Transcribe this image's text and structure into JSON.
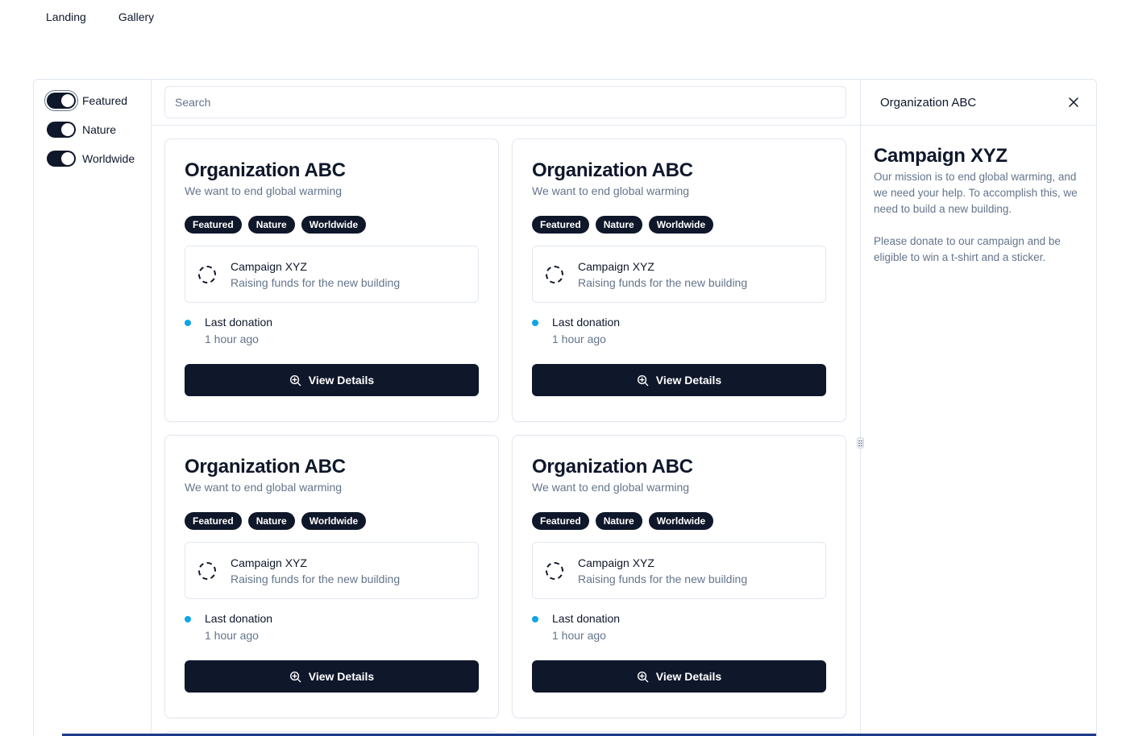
{
  "nav": {
    "items": [
      "Landing",
      "Gallery"
    ]
  },
  "filters": [
    {
      "label": "Featured",
      "on": true
    },
    {
      "label": "Nature",
      "on": true
    },
    {
      "label": "Worldwide",
      "on": true
    }
  ],
  "search": {
    "placeholder": "Search",
    "value": ""
  },
  "cards": [
    {
      "title": "Organization ABC",
      "subtitle": "We want to end global warming",
      "badges": [
        "Featured",
        "Nature",
        "Worldwide"
      ],
      "campaign_title": "Campaign XYZ",
      "campaign_sub": "Raising funds for the new building",
      "donation_label": "Last donation",
      "donation_time": "1 hour ago",
      "button": "View Details"
    },
    {
      "title": "Organization ABC",
      "subtitle": "We want to end global warming",
      "badges": [
        "Featured",
        "Nature",
        "Worldwide"
      ],
      "campaign_title": "Campaign XYZ",
      "campaign_sub": "Raising funds for the new building",
      "donation_label": "Last donation",
      "donation_time": "1 hour ago",
      "button": "View Details"
    },
    {
      "title": "Organization ABC",
      "subtitle": "We want to end global warming",
      "badges": [
        "Featured",
        "Nature",
        "Worldwide"
      ],
      "campaign_title": "Campaign XYZ",
      "campaign_sub": "Raising funds for the new building",
      "donation_label": "Last donation",
      "donation_time": "1 hour ago",
      "button": "View Details"
    },
    {
      "title": "Organization ABC",
      "subtitle": "We want to end global warming",
      "badges": [
        "Featured",
        "Nature",
        "Worldwide"
      ],
      "campaign_title": "Campaign XYZ",
      "campaign_sub": "Raising funds for the new building",
      "donation_label": "Last donation",
      "donation_time": "1 hour ago",
      "button": "View Details"
    }
  ],
  "detail": {
    "org": "Organization ABC",
    "title": "Campaign XYZ",
    "p1": "Our mission is to end global warming, and we need your help. To accomplish this, we need to build a new building.",
    "p2": "Please donate to our campaign and be eligible to win a t-shirt and a sticker."
  },
  "colors": {
    "primary": "#0f172a",
    "muted": "#64748b",
    "border": "#e2e8f0",
    "dot": "#0ea5e9"
  },
  "icons": {
    "spinner": "loader-circle-icon",
    "view": "zoom-in-icon",
    "close": "close-icon",
    "handle": "grip-vertical-icon"
  }
}
